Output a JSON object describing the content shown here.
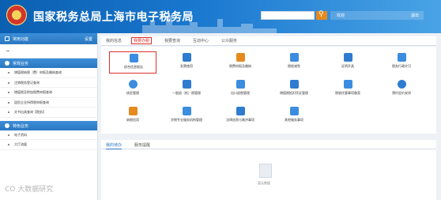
{
  "header": {
    "title": "国家税务总局上海市电子税务局",
    "user_label": "欢迎",
    "exit_label": "退出"
  },
  "sidebar": {
    "common_title": "常用功能",
    "common_action": "设置",
    "section_common": "常规业务",
    "common_items": [
      "增值税纳税（费）申报及缴纳查询",
      "注销税务登记查询",
      "增值税及附加税费申报查询",
      "居民企业所得税申报查询",
      "文书出具查询【税务】"
    ],
    "section_special": "特色业务",
    "special_items": [
      "电子资料",
      "大厅流量"
    ]
  },
  "main": {
    "tabs": [
      "我的信息",
      "我要办税",
      "我要查询",
      "互动中心",
      "公众服务"
    ],
    "active_tab_index": 1,
    "functions_row1": [
      "综合信息报告",
      "发票使用",
      "税费申报及缴纳",
      "税收减免",
      "证明开具",
      "税务行政许可"
    ],
    "functions_row2": [
      "核定管理",
      "一般退（抵）税管理",
      "出口退税管理",
      "增值税抵扣凭证管理",
      "税收优惠事项备案",
      "预约定价安排"
    ],
    "functions_row3": [
      "纳税信用",
      "涉税专业服务机构管理",
      "法律追责与救济事项",
      "其他服务事项"
    ],
    "highlighted_function": "综合信息报告",
    "lower_tabs": [
      "我的待办",
      "服务提醒"
    ],
    "empty_text": "暂无数据"
  },
  "watermark": "CO 大数据研究",
  "colors": {
    "header_start": "#0b5fb0",
    "header_end": "#4aa3e6",
    "highlight_red": "#d9302a",
    "accent_blue": "#2a77c2",
    "accent_orange": "#e58a1f"
  }
}
